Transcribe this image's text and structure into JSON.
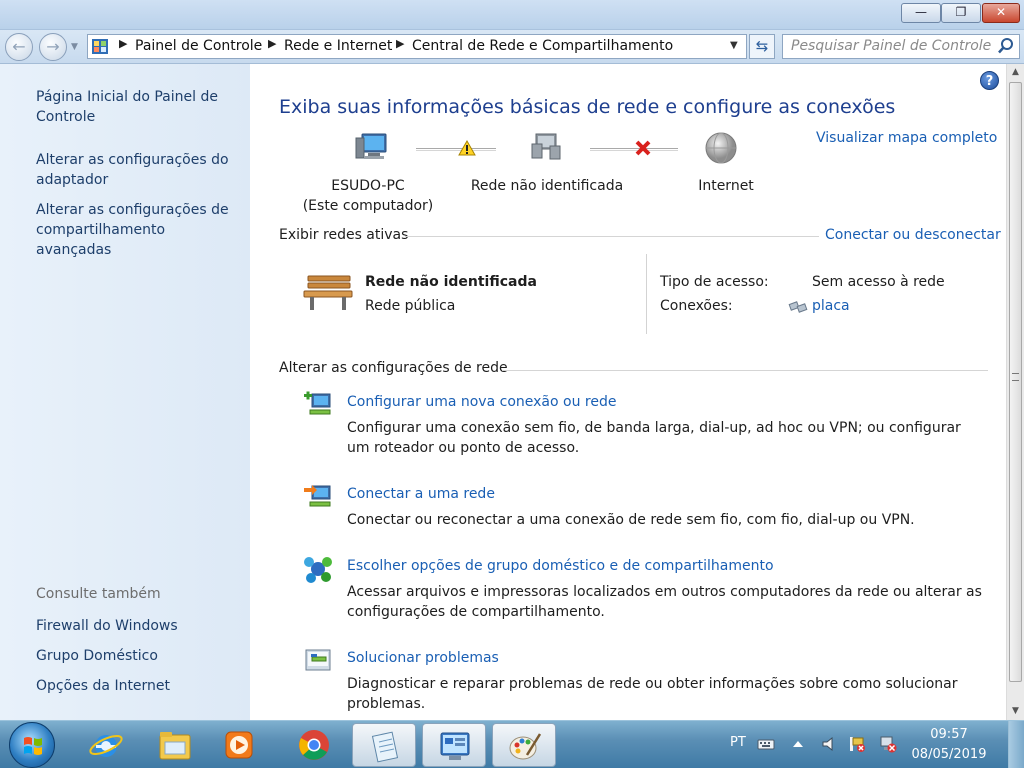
{
  "window": {
    "minimize_label": "—",
    "maximize_label": "❐",
    "close_label": "✕"
  },
  "address": {
    "breadcrumbs": [
      "Painel de Controle",
      "Rede e Internet",
      "Central de Rede e Compartilhamento"
    ],
    "search_placeholder": "Pesquisar Painel de Controle"
  },
  "sidebar": {
    "links": [
      "Página Inicial do Painel de Controle",
      "Alterar as configurações do adaptador",
      "Alterar as configurações de compartilhamento avançadas"
    ],
    "see_also_heading": "Consulte também",
    "see_also": [
      "Firewall do Windows",
      "Grupo Doméstico",
      "Opções da Internet"
    ]
  },
  "main": {
    "help_label": "?",
    "title": "Exiba suas informações básicas de rede e configure as conexões",
    "view_full_map": "Visualizar mapa completo",
    "map": {
      "computer_name": "ESUDO-PC",
      "computer_sub": "(Este computador)",
      "network": "Rede não identificada",
      "internet": "Internet"
    },
    "active_networks_heading": "Exibir redes ativas",
    "connect_disconnect": "Conectar ou desconectar",
    "active_network": {
      "name": "Rede não identificada",
      "category": "Rede pública",
      "access_type_label": "Tipo de acesso:",
      "access_type_value": "Sem acesso à rede",
      "connections_label": "Conexões:",
      "connections_value": "placa"
    },
    "change_settings_heading": "Alterar as configurações de rede",
    "tasks": [
      {
        "title": "Configurar uma nova conexão ou rede",
        "desc": "Configurar uma conexão sem fio, de banda larga, dial-up, ad hoc ou VPN; ou configurar um roteador ou ponto de acesso."
      },
      {
        "title": "Conectar a uma rede",
        "desc": "Conectar ou reconectar a uma conexão de rede sem fio, com fio, dial-up ou VPN."
      },
      {
        "title": "Escolher opções de grupo doméstico e de compartilhamento",
        "desc": "Acessar arquivos e impressoras localizados em outros computadores da rede ou alterar as configurações de compartilhamento."
      },
      {
        "title": "Solucionar problemas",
        "desc": "Diagnosticar e reparar problemas de rede ou obter informações sobre como solucionar problemas."
      }
    ]
  },
  "taskbar": {
    "language": "PT",
    "time": "09:57",
    "date": "08/05/2019",
    "apps": [
      "internet-explorer",
      "windows-explorer",
      "media-player",
      "chrome",
      "notepad",
      "network-center",
      "paint"
    ]
  },
  "colors": {
    "link": "#1a5fb4",
    "title": "#1e3f8f",
    "sidebar_link": "#1e3f6b",
    "left_pane_bg": "#e3eef9"
  }
}
